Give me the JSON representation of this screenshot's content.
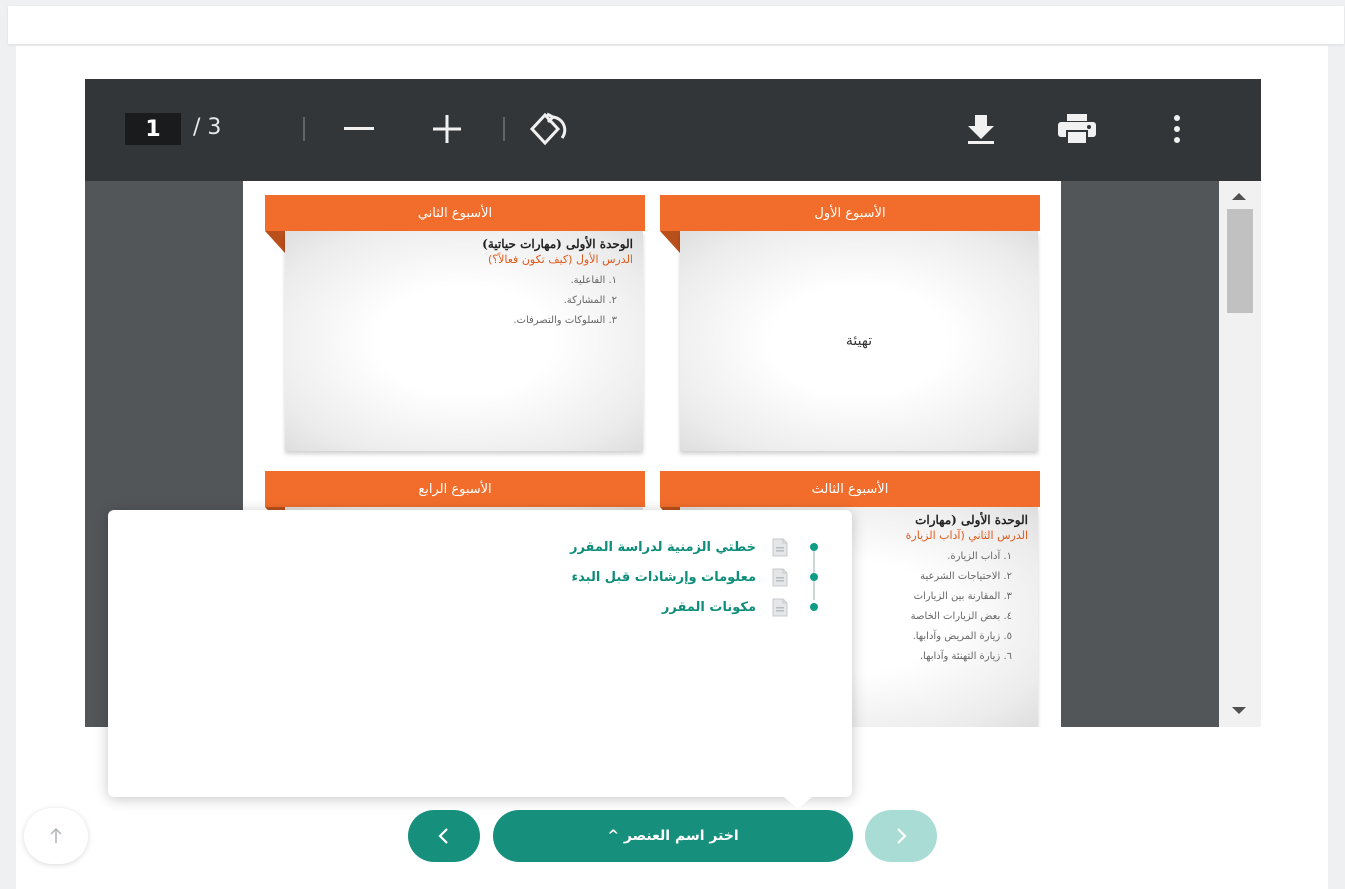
{
  "pdf_viewer": {
    "current_page": "1",
    "page_total": "/ 3",
    "toolbar_icons": [
      "zoom-out-icon",
      "zoom-in-icon",
      "rotate-icon",
      "download-icon",
      "print-icon",
      "more-options-icon"
    ]
  },
  "slides": {
    "week1": {
      "header": "الأسبوع الأول",
      "center_text": "تهيئة"
    },
    "week2": {
      "header": "الأسبوع الثاني",
      "title": "الوحدة الأولى (مهارات حياتية)",
      "lesson": "الدرس الأول (كيف تكون فعالاً؟)",
      "lines": [
        "١. الفاعلية.",
        "٢. المشاركة.",
        "٣. السلوكات والتصرفات."
      ]
    },
    "week3": {
      "header": "الأسبوع الثالث",
      "title": "الوحدة الأولى (مهارات",
      "lesson": "الدرس الثاني (آداب الزيارة",
      "lines": [
        "١. آداب الزيارة.",
        "٢. الاحتياجات الشرعية",
        "٣. المقارنة بين الزيارات",
        "٤. بعض الزيارات الخاصة",
        "٥. زيارة المريض وآدابها.",
        "٦. زيارة التهنئة وآدابها."
      ]
    },
    "week4": {
      "header": "الأسبوع الرابع"
    }
  },
  "popup_menu": {
    "items": [
      {
        "label": "خطتي الزمنية لدراسة المقرر",
        "icon": "document-icon"
      },
      {
        "label": "معلومات وإرشادات قبل البدء",
        "icon": "document-icon"
      },
      {
        "label": "مكونات المقرر",
        "icon": "document-icon"
      }
    ]
  },
  "bottom_nav": {
    "select_element_label": "اختر اسم العنصر ^",
    "prev_icon": "chevron-left-icon",
    "next_icon": "chevron-right-icon",
    "scroll_top_icon": "arrow-up-icon"
  },
  "colors": {
    "toolbar": "#323639",
    "slide_header": "#f26d2b",
    "accent_teal": "#168f7d",
    "disabled_teal": "#a9dcd4"
  }
}
